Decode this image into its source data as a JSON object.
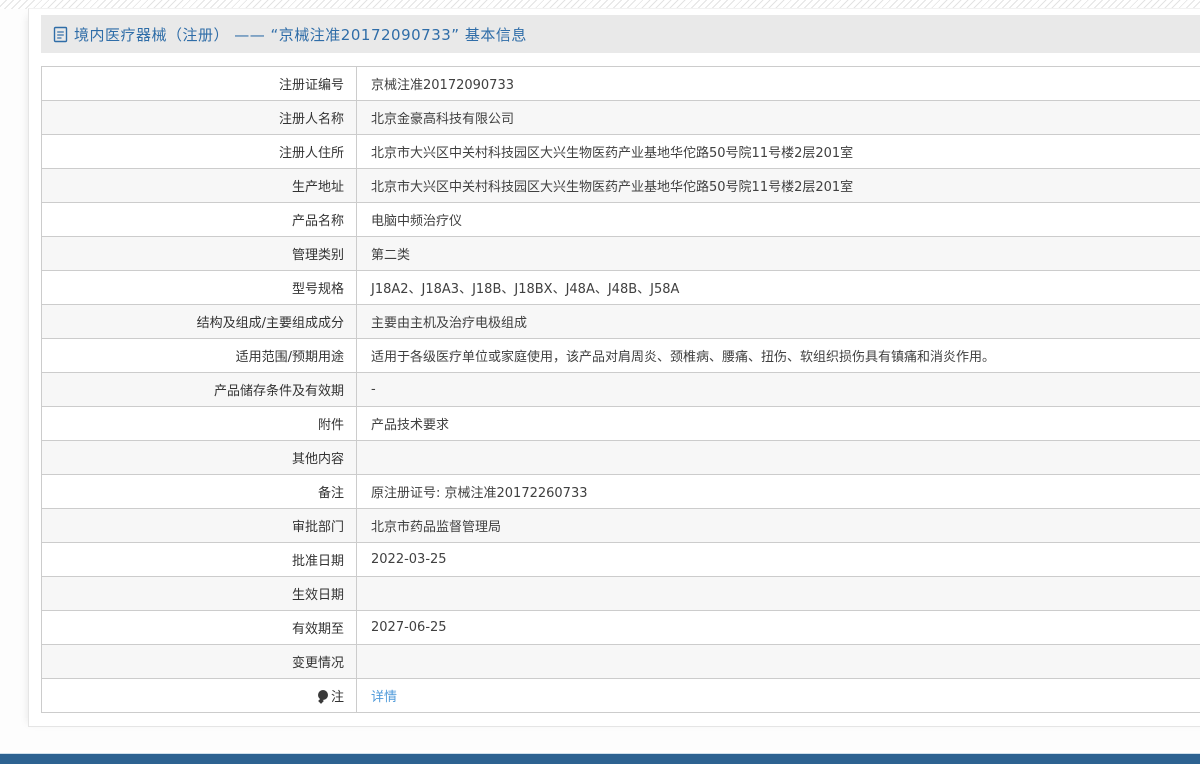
{
  "header": {
    "title": "境内医疗器械（注册） —— “京械注准20172090733” 基本信息",
    "icon": "document-icon"
  },
  "table": {
    "rows": [
      {
        "label": "注册证编号",
        "value": "京械注准20172090733"
      },
      {
        "label": "注册人名称",
        "value": "北京金豪高科技有限公司"
      },
      {
        "label": "注册人住所",
        "value": "北京市大兴区中关村科技园区大兴生物医药产业基地华佗路50号院11号楼2层201室"
      },
      {
        "label": "生产地址",
        "value": "北京市大兴区中关村科技园区大兴生物医药产业基地华佗路50号院11号楼2层201室"
      },
      {
        "label": "产品名称",
        "value": "电脑中频治疗仪"
      },
      {
        "label": "管理类别",
        "value": "第二类"
      },
      {
        "label": "型号规格",
        "value": "J18A2、J18A3、J18B、J18BX、J48A、J48B、J58A"
      },
      {
        "label": "结构及组成/主要组成成分",
        "value": "主要由主机及治疗电极组成"
      },
      {
        "label": "适用范围/预期用途",
        "value": "适用于各级医疗单位或家庭使用，该产品对肩周炎、颈椎病、腰痛、扭伤、软组织损伤具有镇痛和消炎作用。"
      },
      {
        "label": "产品储存条件及有效期",
        "value": "-"
      },
      {
        "label": "附件",
        "value": "产品技术要求"
      },
      {
        "label": "其他内容",
        "value": ""
      },
      {
        "label": "备注",
        "value": "原注册证号: 京械注准20172260733"
      },
      {
        "label": "审批部门",
        "value": "北京市药品监督管理局"
      },
      {
        "label": "批准日期",
        "value": "2022-03-25"
      },
      {
        "label": "生效日期",
        "value": ""
      },
      {
        "label": "有效期至",
        "value": "2027-06-25"
      },
      {
        "label": "变更情况",
        "value": ""
      },
      {
        "label": "注",
        "value": "详情",
        "value_is_link": true,
        "label_icon": "bulb-icon"
      }
    ]
  },
  "colors": {
    "title_blue": "#2f6da8",
    "link_blue": "#4f9ada",
    "band_gray": "#e9e9e9",
    "alt_row_gray": "#f7f7f7",
    "table_border": "#cccccc",
    "bottom_bar_blue": "#2d6291"
  }
}
